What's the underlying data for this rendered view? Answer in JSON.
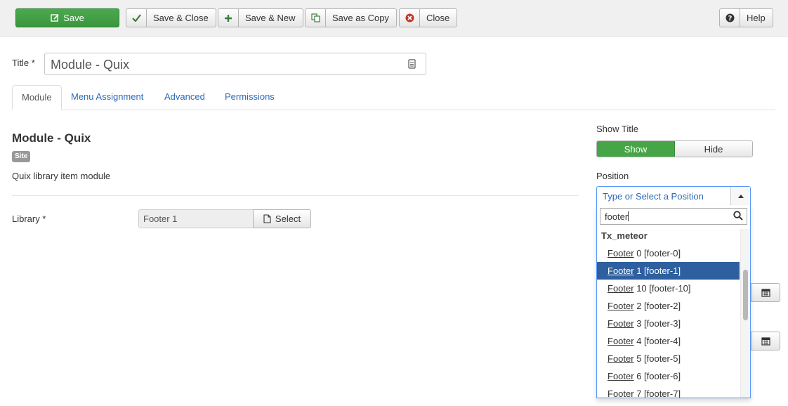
{
  "toolbar": {
    "save_label": "Save",
    "save_close_label": "Save & Close",
    "save_new_label": "Save & New",
    "save_copy_label": "Save as Copy",
    "close_label": "Close",
    "help_label": "Help"
  },
  "form": {
    "title_label": "Title *",
    "title_value": "Module - Quix"
  },
  "tabs": [
    {
      "label": "Module",
      "active": true
    },
    {
      "label": "Menu Assignment",
      "active": false
    },
    {
      "label": "Advanced",
      "active": false
    },
    {
      "label": "Permissions",
      "active": false
    }
  ],
  "module": {
    "heading": "Module - Quix",
    "badge": "Site",
    "description": "Quix library item module",
    "library_label": "Library *",
    "library_value": "Footer 1",
    "select_label": "Select"
  },
  "sidebar": {
    "show_title_label": "Show Title",
    "show_label": "Show",
    "hide_label": "Hide",
    "show_title_selected": "Show",
    "position_label": "Position",
    "position_placeholder": "Type or Select a Position",
    "search_value": "footer",
    "group": "Tx_meteor",
    "options": [
      {
        "match": "Footer",
        "rest": " 0 [footer-0]",
        "highlighted": false
      },
      {
        "match": "Footer",
        "rest": " 1 [footer-1]",
        "highlighted": true
      },
      {
        "match": "Footer",
        "rest": " 10 [footer-10]",
        "highlighted": false
      },
      {
        "match": "Footer",
        "rest": " 2 [footer-2]",
        "highlighted": false
      },
      {
        "match": "Footer",
        "rest": " 3 [footer-3]",
        "highlighted": false
      },
      {
        "match": "Footer",
        "rest": " 4 [footer-4]",
        "highlighted": false
      },
      {
        "match": "Footer",
        "rest": " 5 [footer-5]",
        "highlighted": false
      },
      {
        "match": "Footer",
        "rest": " 6 [footer-6]",
        "highlighted": false
      },
      {
        "match": "Footer",
        "rest": " 7 [footer-7]",
        "highlighted": false
      }
    ]
  },
  "colors": {
    "save_green": "#3b973e",
    "toggle_green": "#46a546",
    "link_blue": "#2a69b8",
    "highlight_blue": "#2e5f9e",
    "close_red": "#c0392b"
  },
  "icons": {
    "save": "edit-icon",
    "save_close": "check-icon",
    "save_new": "plus-icon",
    "save_copy": "copy-icon",
    "close": "close-circle-icon",
    "help": "question-circle-icon",
    "title_field": "field-options-icon",
    "select": "file-icon",
    "dropdown": "caret-up-icon",
    "search": "search-icon",
    "calendar": "calendar-icon"
  }
}
